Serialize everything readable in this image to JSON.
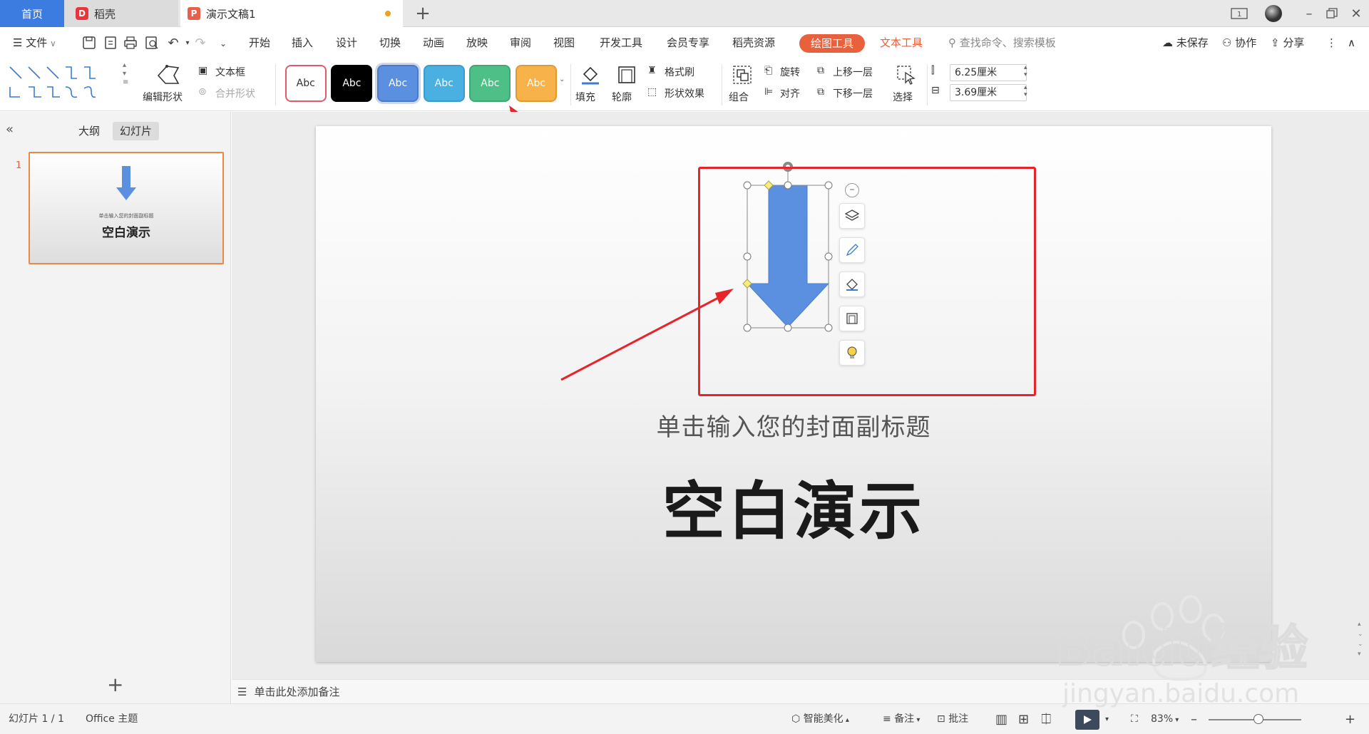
{
  "tabs": {
    "home": "首页",
    "daoke": "稻壳",
    "doc": "演示文稿1",
    "daoke_logo": "D",
    "doc_logo": "P"
  },
  "menu": {
    "file": "文件",
    "items": [
      "开始",
      "插入",
      "设计",
      "切换",
      "动画",
      "放映",
      "审阅",
      "视图",
      "开发工具",
      "会员专享",
      "稻壳资源"
    ],
    "drawing_tool": "绘图工具",
    "text_tool": "文本工具",
    "search": "查找命令、搜索模板",
    "unsaved": "未保存",
    "collab": "协作",
    "share": "分享"
  },
  "ribbon": {
    "edit_shape": "编辑形状",
    "text_box": "文本框",
    "merge_shape": "合并形状",
    "style_label": "Abc",
    "styles": [
      {
        "bg": "#ffffff",
        "fg": "#333333",
        "border": "#e05a6a"
      },
      {
        "bg": "#000000",
        "fg": "#ffffff",
        "border": "#000000"
      },
      {
        "bg": "#5b8fe0",
        "fg": "#ffffff",
        "border": "#4b7bc8"
      },
      {
        "bg": "#4ab0e2",
        "fg": "#ffffff",
        "border": "#3a9ccc"
      },
      {
        "bg": "#4fbf88",
        "fg": "#ffffff",
        "border": "#3fa874"
      },
      {
        "bg": "#f8b24a",
        "fg": "#ffffff",
        "border": "#e09a34"
      }
    ],
    "fill": "填充",
    "outline": "轮廓",
    "format_painter": "格式刷",
    "shape_effect": "形状效果",
    "group": "组合",
    "rotate": "旋转",
    "align": "对齐",
    "bring_forward": "上移一层",
    "send_backward": "下移一层",
    "select": "选择",
    "height": "6.25厘米",
    "width": "3.69厘米"
  },
  "left_panel": {
    "outline_tab": "大纲",
    "slides_tab": "幻灯片",
    "slide_number": "1",
    "thumb_subtitle": "单击输入您的封面副标题",
    "thumb_title": "空白演示"
  },
  "slide": {
    "subtitle": "单击输入您的封面副标题",
    "title": "空白演示",
    "arrow_color": "#5b8fe0"
  },
  "notes": "单击此处添加备注",
  "status": {
    "slide_count": "幻灯片 1 / 1",
    "theme": "Office 主题",
    "beautify": "智能美化",
    "notes": "备注",
    "comments": "批注",
    "zoom": "83%"
  },
  "watermark": {
    "brand": "Baidu经验",
    "url": "jingyan.baidu.com"
  },
  "colors": {
    "accent": "#3c7be0",
    "drawing_tool": "#e8613c",
    "annotation_red": "#e8232a"
  }
}
